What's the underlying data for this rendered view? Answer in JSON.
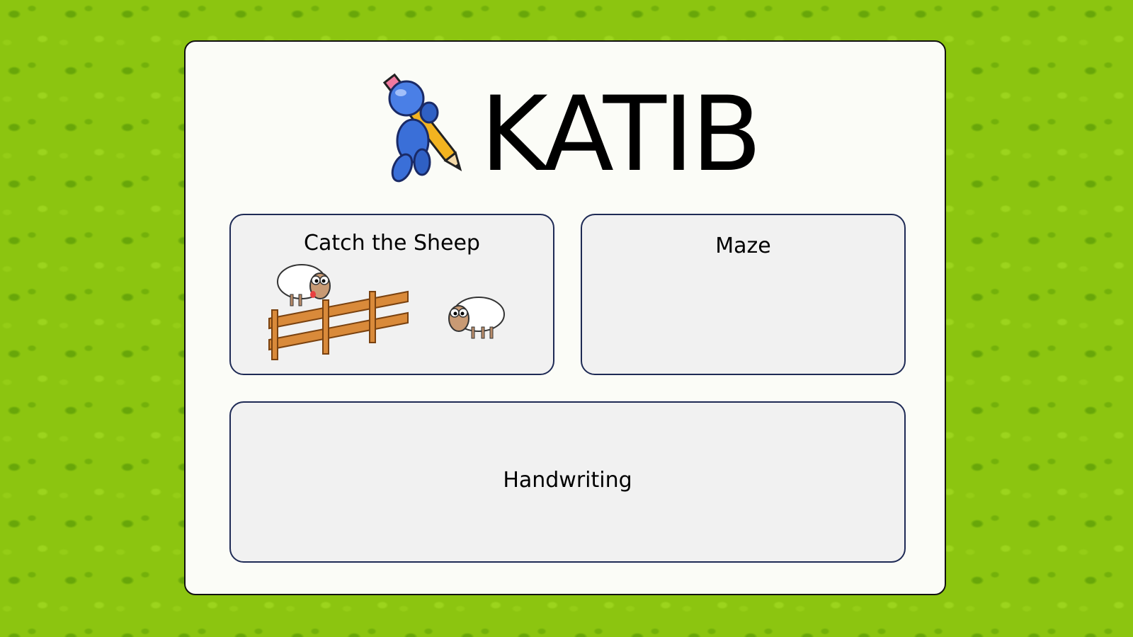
{
  "app": {
    "title": "KATIB",
    "logo_icon": "pencil-mascot-icon"
  },
  "games": [
    {
      "label": "Catch the Sheep",
      "icon": "sheep-fence-illustration"
    },
    {
      "label": "Maze"
    },
    {
      "label": "Handwriting"
    }
  ],
  "colors": {
    "background": "#8cc510",
    "panel": "#fbfcf7",
    "card": "#f1f1f1",
    "card_border": "#1e2a55",
    "mascot": "#3a6fd8",
    "pencil": "#f2b320"
  }
}
